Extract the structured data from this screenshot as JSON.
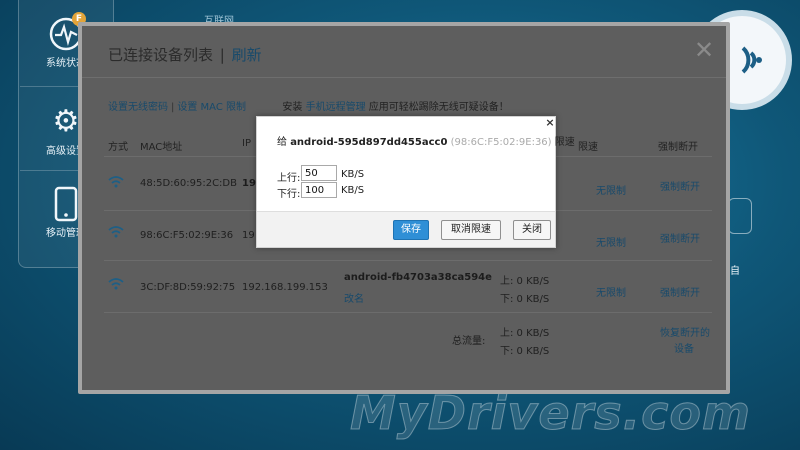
{
  "background": {
    "nav_items": [
      {
        "label": "系统状态",
        "icon": "heartbeat-icon",
        "badge": "F"
      },
      {
        "label": "高级设置",
        "icon": "gear-icon"
      },
      {
        "label": "移动管理",
        "icon": "phone-icon"
      }
    ],
    "top_text": "互联网",
    "right_text": "自",
    "watermark": "MyDrivers.com"
  },
  "main_dialog": {
    "title": "已连接设备列表",
    "separator": "|",
    "refresh_label": "刷新",
    "close_glyph": "✕",
    "links": {
      "set_password": "设置无线密码",
      "pipe": "|",
      "set_mac_limit": "设置 MAC 限制",
      "install_prefix": "安装",
      "app_link": "手机远程管理",
      "install_suffix": "应用可轻松踢除无线可疑设备！"
    },
    "columns": {
      "mode": "方式",
      "mac": "MAC地址",
      "ip": "IP",
      "limit": "限速",
      "force_disconnect": "强制断开"
    },
    "rows": [
      {
        "mac": "48:5D:60:95:2C:DB",
        "ip": "19",
        "limit": "无限制",
        "action": "强制断开"
      },
      {
        "mac": "98:6C:F5:02:9E:36",
        "ip": "19",
        "limit": "无限制",
        "action": "强制断开"
      },
      {
        "mac": "3C:DF:8D:59:92:75",
        "ip": "192.168.199.153",
        "name": "android-fb4703a38ca594e",
        "rename": "改名",
        "up": "上: 0 KB/S",
        "down": "下: 0 KB/S",
        "limit": "无限制",
        "action": "强制断开"
      }
    ],
    "total": {
      "label": "总流量:",
      "up": "上: 0 KB/S",
      "down": "下: 0 KB/S",
      "restore_line1": "恢复断开的",
      "restore_line2": "设备"
    }
  },
  "modal": {
    "close_glyph": "×",
    "title_prefix": "给",
    "device": "android-595d897dd455acc0",
    "mac": "(98:6C:F5:02:9E:36)",
    "title_suffix": "限速",
    "upload_label": "上行:",
    "upload_value": "50",
    "download_label": "下行:",
    "download_value": "100",
    "unit": "KB/S",
    "save": "保存",
    "cancel_limit": "取消限速",
    "close": "关闭"
  },
  "colors": {
    "link": "#184a6b",
    "primary_button": "#2f8fd6",
    "overlay_dialog": "#5e5e5e"
  }
}
